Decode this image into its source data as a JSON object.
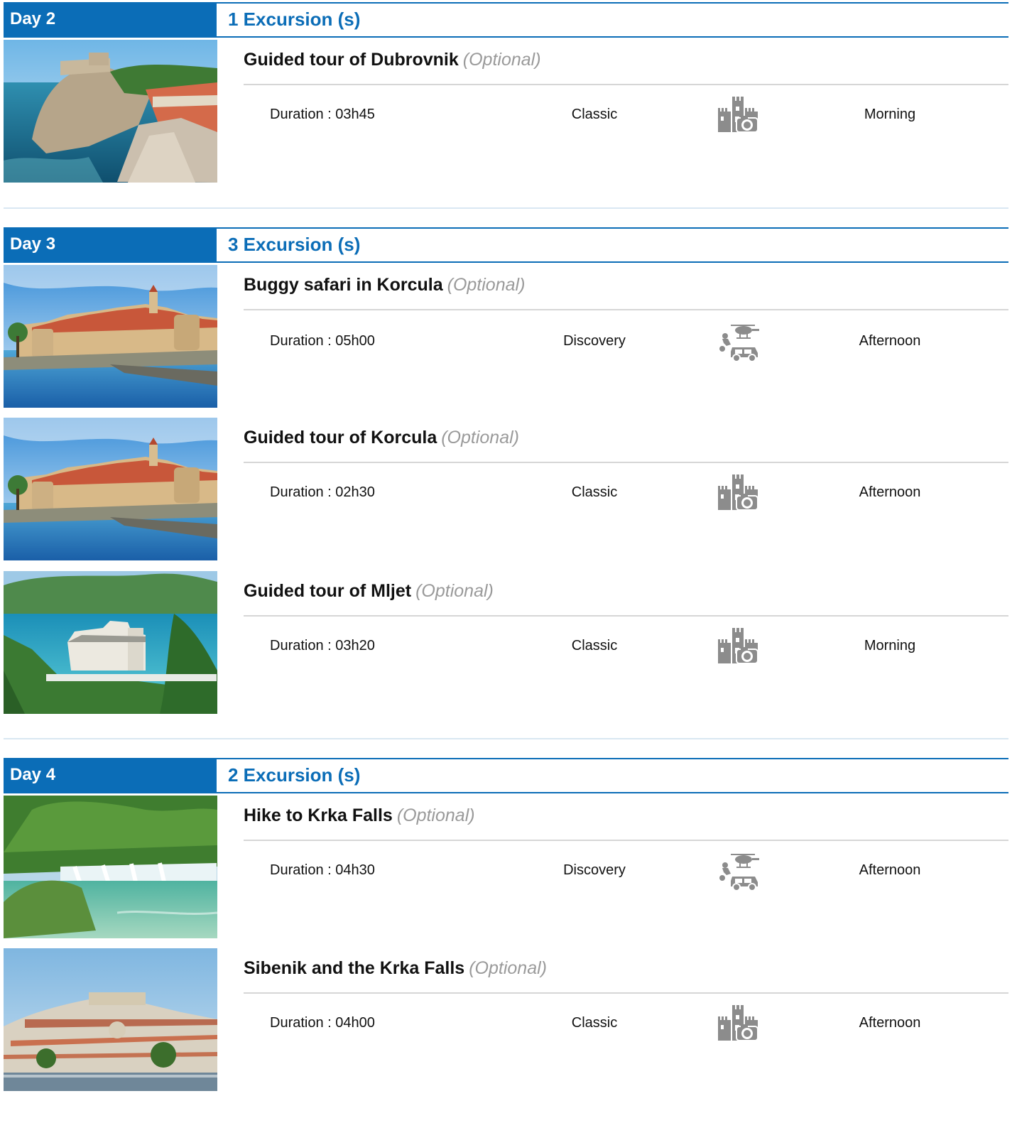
{
  "colors": {
    "accent": "#0b6db7",
    "optional": "#9a9a9a",
    "icon": "#8c8c8c"
  },
  "days": [
    {
      "label": "Day 2",
      "count": "1 Excursion (s)",
      "excursions": [
        {
          "title": "Guided tour of Dubrovnik",
          "optional": "(Optional)",
          "duration": "Duration : 03h45",
          "level": "Classic",
          "icon": "castle-camera-icon",
          "time": "Morning",
          "image": "dubrovnik-fortress-coast"
        }
      ]
    },
    {
      "label": "Day 3",
      "count": "3 Excursion (s)",
      "excursions": [
        {
          "title": "Buggy safari in Korcula",
          "optional": "(Optional)",
          "duration": "Duration : 05h00",
          "level": "Discovery",
          "icon": "activity-vehicles-icon",
          "time": "Afternoon",
          "image": "korcula-old-town"
        },
        {
          "title": "Guided tour of Korcula",
          "optional": "(Optional)",
          "duration": "Duration : 02h30",
          "level": "Classic",
          "icon": "castle-camera-icon",
          "time": "Afternoon",
          "image": "korcula-old-town"
        },
        {
          "title": "Guided tour of Mljet",
          "optional": "(Optional)",
          "duration": "Duration : 03h20",
          "level": "Classic",
          "icon": "castle-camera-icon",
          "time": "Morning",
          "image": "mljet-monastery-lake"
        }
      ]
    },
    {
      "label": "Day 4",
      "count": "2 Excursion (s)",
      "excursions": [
        {
          "title": "Hike to Krka Falls",
          "optional": "(Optional)",
          "duration": "Duration : 04h30",
          "level": "Discovery",
          "icon": "activity-vehicles-icon",
          "time": "Afternoon",
          "image": "krka-waterfalls"
        },
        {
          "title": "Sibenik and the Krka Falls",
          "optional": "(Optional)",
          "duration": "Duration : 04h00",
          "level": "Classic",
          "icon": "castle-camera-icon",
          "time": "Afternoon",
          "image": "sibenik-hillside-town"
        }
      ]
    }
  ]
}
